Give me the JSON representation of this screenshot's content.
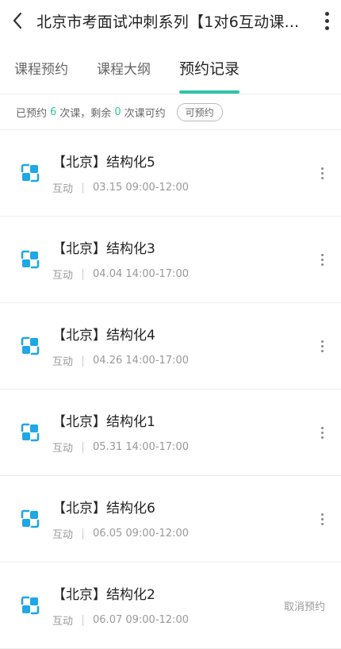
{
  "header": {
    "title": "北京市考面试冲刺系列【1对6互动课..."
  },
  "tabs": [
    {
      "label": "课程预约",
      "active": false
    },
    {
      "label": "课程大纲",
      "active": false
    },
    {
      "label": "预约记录",
      "active": true
    }
  ],
  "colors": {
    "accent": "#2ec4a6",
    "icon": "#1fa7e6"
  },
  "summary": {
    "prefix": "已预约",
    "booked": "6",
    "mid": "次课，剩余",
    "remaining": "0",
    "suffix": "次课可约",
    "pill_label": "可预约"
  },
  "items": [
    {
      "title": "【北京】结构化5",
      "type": "互动",
      "time": "03.15 09:00-12:00",
      "action": "more"
    },
    {
      "title": "【北京】结构化3",
      "type": "互动",
      "time": "04.04 14:00-17:00",
      "action": "more"
    },
    {
      "title": "【北京】结构化4",
      "type": "互动",
      "time": "04.26 14:00-17:00",
      "action": "more"
    },
    {
      "title": "【北京】结构化1",
      "type": "互动",
      "time": "05.31 14:00-17:00",
      "action": "more"
    },
    {
      "title": "【北京】结构化6",
      "type": "互动",
      "time": "06.05 09:00-12:00",
      "action": "more"
    },
    {
      "title": "【北京】结构化2",
      "type": "互动",
      "time": "06.07 09:00-12:00",
      "action": "cancel",
      "action_label": "取消预约"
    }
  ]
}
